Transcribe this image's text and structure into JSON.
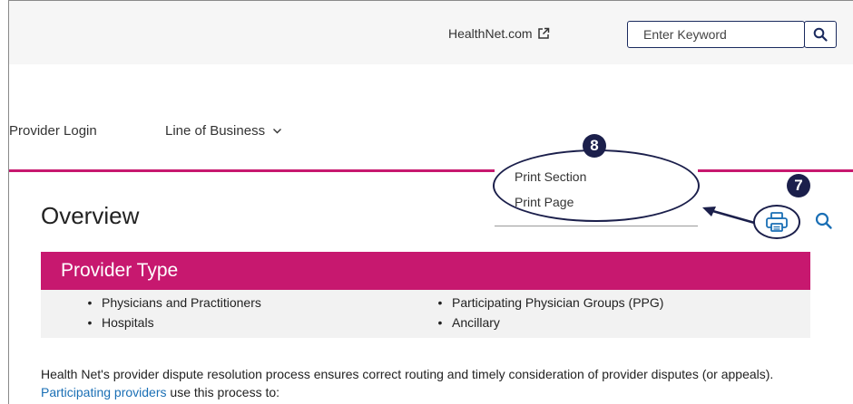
{
  "header": {
    "external_link": "HealthNet.com",
    "search_placeholder": "Enter Keyword"
  },
  "nav": {
    "items": [
      {
        "label": "Provider Login"
      },
      {
        "label": "Line of Business"
      }
    ]
  },
  "print_menu": {
    "items": [
      "Print Section",
      "Print Page"
    ]
  },
  "annotations": {
    "badge_8": "8",
    "badge_7": "7"
  },
  "page": {
    "title": "Overview"
  },
  "provider_type": {
    "heading": "Provider Type",
    "items": [
      "Physicians and Practitioners",
      "Hospitals",
      "Participating Physician Groups (PPG)",
      "Ancillary"
    ],
    "bullet": "•"
  },
  "body": {
    "text_before": "Health Net's provider dispute resolution process ensures correct routing and timely consideration of provider disputes (or appeals). ",
    "link": "Participating providers",
    "text_after": " use this process to:"
  },
  "colors": {
    "accent_pink": "#c7186f",
    "annotation_navy": "#1b1f4b",
    "link_blue": "#1a6fb5"
  }
}
